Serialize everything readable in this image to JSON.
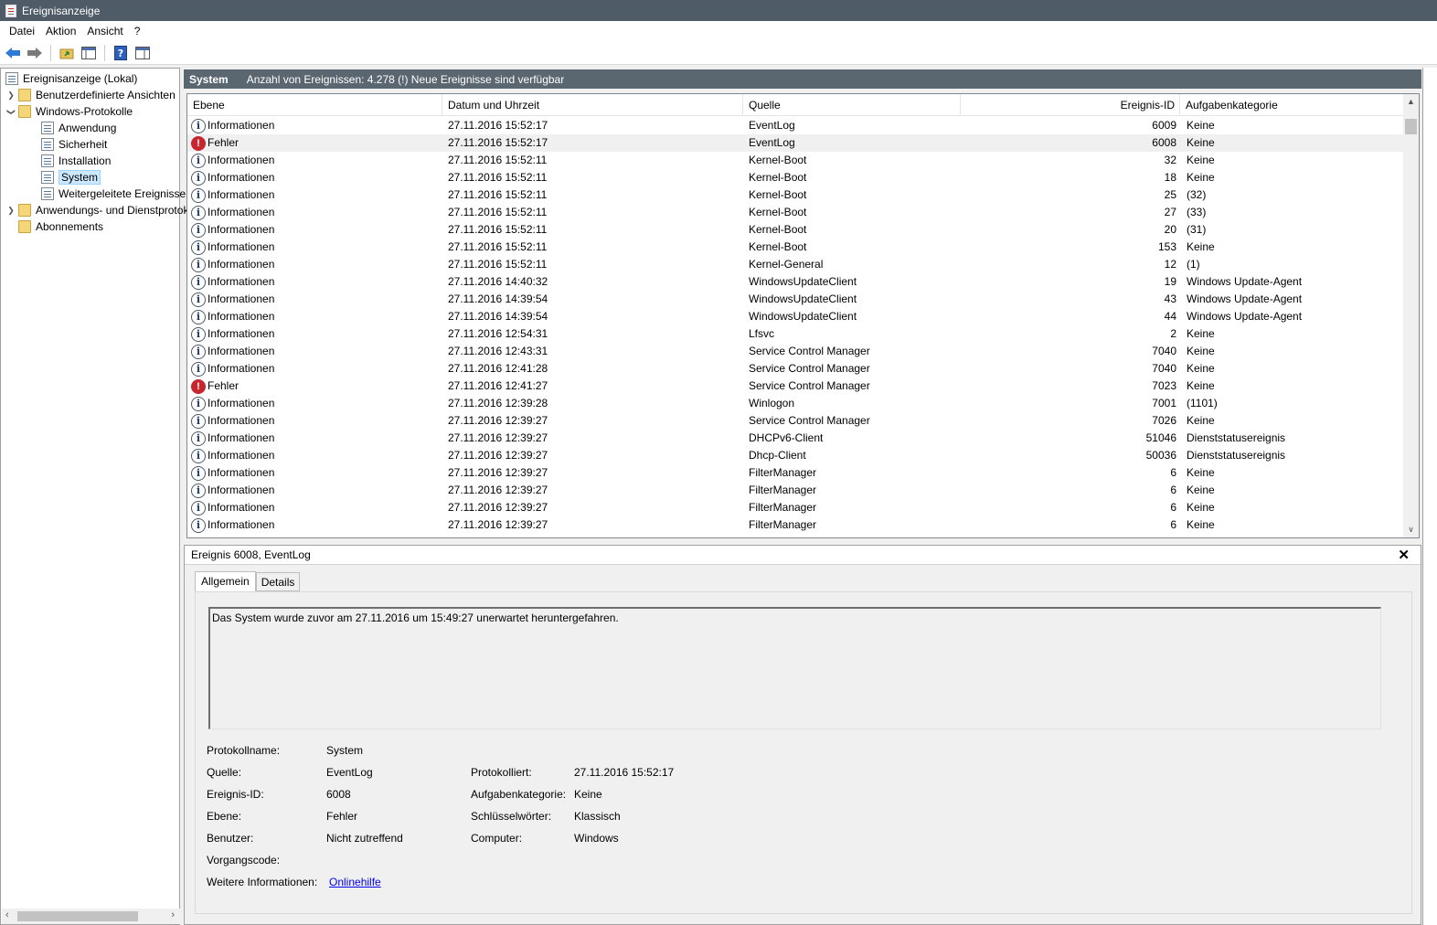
{
  "window": {
    "title": "Ereignisanzeige"
  },
  "menu": [
    "Datei",
    "Aktion",
    "Ansicht",
    "?"
  ],
  "tree": {
    "root": "Ereignisanzeige (Lokal)",
    "items": [
      {
        "label": "Benutzerdefinierte Ansichten",
        "level": 1,
        "expander": "collapsed"
      },
      {
        "label": "Windows-Protokolle",
        "level": 1,
        "expander": "expanded"
      },
      {
        "label": "Anwendung",
        "level": 2
      },
      {
        "label": "Sicherheit",
        "level": 2
      },
      {
        "label": "Installation",
        "level": 2
      },
      {
        "label": "System",
        "level": 2,
        "selected": true
      },
      {
        "label": "Weitergeleitete Ereignisse",
        "level": 2
      },
      {
        "label": "Anwendungs- und Dienstprotokolle",
        "level": 1,
        "expander": "collapsed"
      },
      {
        "label": "Abonnements",
        "level": 1
      }
    ]
  },
  "list": {
    "log_name": "System",
    "status": "Anzahl von Ereignissen: 4.278 (!) Neue Ereignisse sind verfügbar",
    "columns": [
      "Ebene",
      "Datum und Uhrzeit",
      "Quelle",
      "Ereignis-ID",
      "Aufgabenkategorie"
    ],
    "rows": [
      {
        "level": "Informationen",
        "type": "info",
        "date": "27.11.2016 15:52:17",
        "source": "EventLog",
        "id": "6009",
        "category": "Keine"
      },
      {
        "level": "Fehler",
        "type": "error",
        "date": "27.11.2016 15:52:17",
        "source": "EventLog",
        "id": "6008",
        "category": "Keine",
        "selected": true
      },
      {
        "level": "Informationen",
        "type": "info",
        "date": "27.11.2016 15:52:11",
        "source": "Kernel-Boot",
        "id": "32",
        "category": "Keine"
      },
      {
        "level": "Informationen",
        "type": "info",
        "date": "27.11.2016 15:52:11",
        "source": "Kernel-Boot",
        "id": "18",
        "category": "Keine"
      },
      {
        "level": "Informationen",
        "type": "info",
        "date": "27.11.2016 15:52:11",
        "source": "Kernel-Boot",
        "id": "25",
        "category": "(32)"
      },
      {
        "level": "Informationen",
        "type": "info",
        "date": "27.11.2016 15:52:11",
        "source": "Kernel-Boot",
        "id": "27",
        "category": "(33)"
      },
      {
        "level": "Informationen",
        "type": "info",
        "date": "27.11.2016 15:52:11",
        "source": "Kernel-Boot",
        "id": "20",
        "category": "(31)"
      },
      {
        "level": "Informationen",
        "type": "info",
        "date": "27.11.2016 15:52:11",
        "source": "Kernel-Boot",
        "id": "153",
        "category": "Keine"
      },
      {
        "level": "Informationen",
        "type": "info",
        "date": "27.11.2016 15:52:11",
        "source": "Kernel-General",
        "id": "12",
        "category": "(1)"
      },
      {
        "level": "Informationen",
        "type": "info",
        "date": "27.11.2016 14:40:32",
        "source": "WindowsUpdateClient",
        "id": "19",
        "category": "Windows Update-Agent"
      },
      {
        "level": "Informationen",
        "type": "info",
        "date": "27.11.2016 14:39:54",
        "source": "WindowsUpdateClient",
        "id": "43",
        "category": "Windows Update-Agent"
      },
      {
        "level": "Informationen",
        "type": "info",
        "date": "27.11.2016 14:39:54",
        "source": "WindowsUpdateClient",
        "id": "44",
        "category": "Windows Update-Agent"
      },
      {
        "level": "Informationen",
        "type": "info",
        "date": "27.11.2016 12:54:31",
        "source": "Lfsvc",
        "id": "2",
        "category": "Keine"
      },
      {
        "level": "Informationen",
        "type": "info",
        "date": "27.11.2016 12:43:31",
        "source": "Service Control Manager",
        "id": "7040",
        "category": "Keine"
      },
      {
        "level": "Informationen",
        "type": "info",
        "date": "27.11.2016 12:41:28",
        "source": "Service Control Manager",
        "id": "7040",
        "category": "Keine"
      },
      {
        "level": "Fehler",
        "type": "error",
        "date": "27.11.2016 12:41:27",
        "source": "Service Control Manager",
        "id": "7023",
        "category": "Keine"
      },
      {
        "level": "Informationen",
        "type": "info",
        "date": "27.11.2016 12:39:28",
        "source": "Winlogon",
        "id": "7001",
        "category": "(1101)"
      },
      {
        "level": "Informationen",
        "type": "info",
        "date": "27.11.2016 12:39:27",
        "source": "Service Control Manager",
        "id": "7026",
        "category": "Keine"
      },
      {
        "level": "Informationen",
        "type": "info",
        "date": "27.11.2016 12:39:27",
        "source": "DHCPv6-Client",
        "id": "51046",
        "category": "Dienststatusereignis"
      },
      {
        "level": "Informationen",
        "type": "info",
        "date": "27.11.2016 12:39:27",
        "source": "Dhcp-Client",
        "id": "50036",
        "category": "Dienststatusereignis"
      },
      {
        "level": "Informationen",
        "type": "info",
        "date": "27.11.2016 12:39:27",
        "source": "FilterManager",
        "id": "6",
        "category": "Keine"
      },
      {
        "level": "Informationen",
        "type": "info",
        "date": "27.11.2016 12:39:27",
        "source": "FilterManager",
        "id": "6",
        "category": "Keine"
      },
      {
        "level": "Informationen",
        "type": "info",
        "date": "27.11.2016 12:39:27",
        "source": "FilterManager",
        "id": "6",
        "category": "Keine"
      },
      {
        "level": "Informationen",
        "type": "info",
        "date": "27.11.2016 12:39:27",
        "source": "FilterManager",
        "id": "6",
        "category": "Keine"
      }
    ]
  },
  "detail": {
    "title": "Ereignis 6008, EventLog",
    "tabs": [
      "Allgemein",
      "Details"
    ],
    "message": "Das System wurde zuvor am 27.11.2016 um 15:49:27 unerwartet heruntergefahren.",
    "fields": {
      "log_name_label": "Protokollname:",
      "log_name": "System",
      "source_label": "Quelle:",
      "source": "EventLog",
      "logged_label": "Protokolliert:",
      "logged": "27.11.2016 15:52:17",
      "event_id_label": "Ereignis-ID:",
      "event_id": "6008",
      "task_label": "Aufgabenkategorie:",
      "task": "Keine",
      "level_label": "Ebene:",
      "level": "Fehler",
      "keywords_label": "Schlüsselwörter:",
      "keywords": "Klassisch",
      "user_label": "Benutzer:",
      "user": "Nicht zutreffend",
      "computer_label": "Computer:",
      "computer": "Windows",
      "opcode_label": "Vorgangscode:",
      "more_info_label": "Weitere Informationen:",
      "more_info_link": "Onlinehilfe"
    }
  }
}
